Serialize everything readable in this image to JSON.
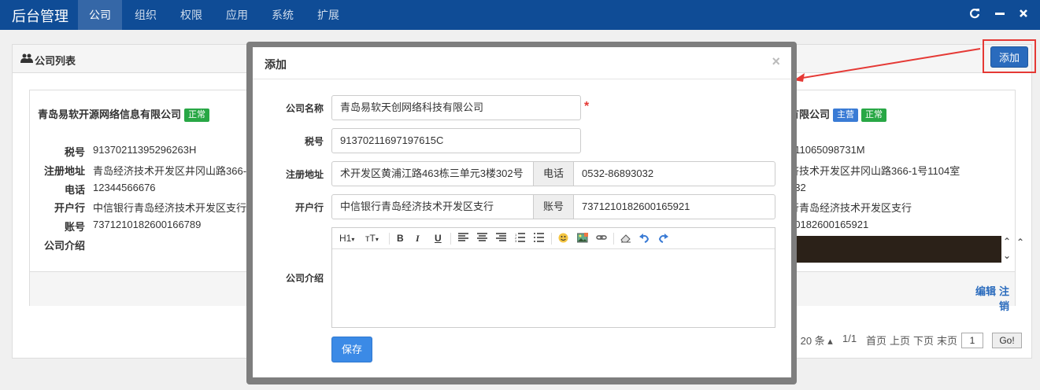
{
  "topbar": {
    "brand": "后台管理",
    "nav": [
      "公司",
      "组织",
      "权限",
      "应用",
      "系统",
      "扩展"
    ],
    "window_icons": [
      "refresh-icon",
      "minimize-icon",
      "close-icon"
    ]
  },
  "panel": {
    "title": "公司列表",
    "add_button": "添加"
  },
  "card_left": {
    "name": "青岛易软开源网络信息有限公司",
    "status": "正常",
    "fields": [
      {
        "label": "税号",
        "value": "91370211395296263H"
      },
      {
        "label": "注册地址",
        "value": "青岛经济技术开发区井冈山路366-1号"
      },
      {
        "label": "电话",
        "value": "12344566676"
      },
      {
        "label": "开户行",
        "value": "中信银行青岛经济技术开发区支行"
      },
      {
        "label": "账号",
        "value": "7371210182600166789"
      },
      {
        "label": "公司介绍",
        "value": ""
      }
    ]
  },
  "card_right": {
    "name_fragment": "有限公司",
    "badge_main": "主营",
    "status": "正常",
    "values": [
      "211065098731M",
      "济技术开发区井冈山路366-1号1104室",
      "032",
      "行青岛经济技术开发区支行",
      "10182600165921"
    ],
    "edit_link": "编辑",
    "cancel_link": "注销"
  },
  "pager": {
    "page_size_text": "页 20 条",
    "page_info": "1/1",
    "first": "首页",
    "prev": "上页",
    "next": "下页",
    "last": "末页",
    "page_input": "1",
    "go": "Go!"
  },
  "modal": {
    "title": "添加",
    "close": "×",
    "company_name_label": "公司名称",
    "company_name_value": "青岛易软天创网络科技有限公司",
    "required_mark": "*",
    "tax_label": "税号",
    "tax_value": "91370211697197615C",
    "address_label": "注册地址",
    "address_value": "术开发区黄浦江路463栋三单元3楼302号",
    "phone_label": "电话",
    "phone_value": "0532-86893032",
    "bank_label": "开户行",
    "bank_value": "中信银行青岛经济技术开发区支行",
    "account_label": "账号",
    "account_value": "7371210182600165921",
    "intro_label": "公司介绍",
    "editor_toolbar": {
      "heading": "H1",
      "font_size": "тT",
      "bold": "B",
      "italic": "I",
      "underline": "U"
    },
    "save_button": "保存"
  },
  "colors": {
    "topbar": "#0f4c96",
    "nav_active": "#3567a7",
    "primary": "#2a6bbd",
    "save": "#3b8ae6",
    "success": "#28a745",
    "highlight": "#e53935"
  }
}
